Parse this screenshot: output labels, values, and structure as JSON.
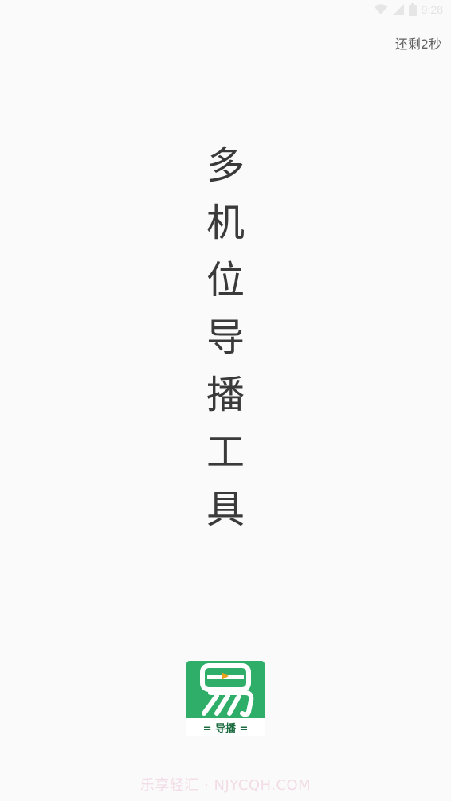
{
  "status_bar": {
    "time": "9:28",
    "icons": [
      "wifi-icon",
      "signal-icon",
      "battery-icon"
    ]
  },
  "skip": {
    "label": "还剩2秒"
  },
  "slogan": {
    "chars": [
      "多",
      "机",
      "位",
      "导",
      "播",
      "工",
      "具"
    ]
  },
  "logo": {
    "glyph": "易",
    "caption": "= 导播 ="
  },
  "footer": {
    "text": "乐享轻汇 · NJYCQH.COM"
  },
  "colors": {
    "logo_green": "#2fae69",
    "logo_play_orange": "#e8a21c",
    "background": "#fafafa",
    "slogan_text": "#3a3a3a"
  }
}
